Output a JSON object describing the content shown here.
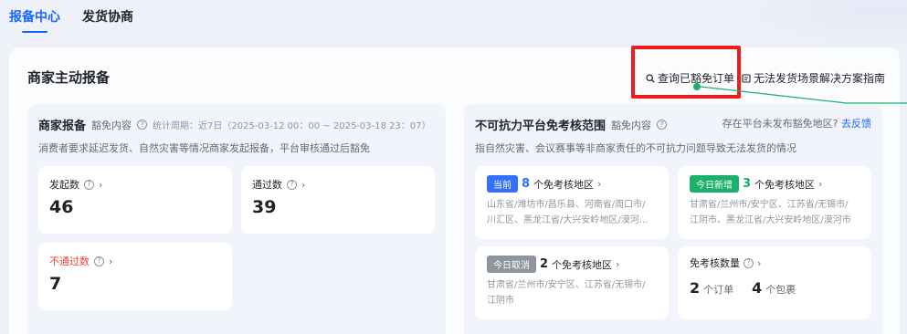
{
  "tabs": [
    {
      "label": "报备中心",
      "active": true
    },
    {
      "label": "发货协商",
      "active": false
    }
  ],
  "header": {
    "title": "商家主动报备",
    "query_link": "查询已豁免订单",
    "guide_link": "无法发货场景解决方案指南"
  },
  "left_panel": {
    "title": "商家报备",
    "subtitle": "豁免内容",
    "period": "统计周期：近7日（2025-03-12 00：00 ~ 2025-03-18 23：07）",
    "description": "消费者要求延迟发货、自然灾害等情况商家发起报备，平台审核通过后豁免",
    "stats": [
      {
        "label": "发起数",
        "value": "46"
      },
      {
        "label": "通过数",
        "value": "39"
      },
      {
        "label": "不通过数",
        "value": "7",
        "label_color": "#f53f3f"
      }
    ]
  },
  "right_panel": {
    "title": "不可抗力平台免考核范围",
    "subtitle": "豁免内容",
    "feedback_prefix": "存在平台未发布豁免地区?",
    "feedback_link": "去反馈",
    "description": "指自然灾害、会议赛事等非商家责任的不可抗力问题导致无法发货的情况",
    "cards": [
      {
        "badge": "当前",
        "badge_color": "#3370ff",
        "count": "8",
        "count_color": "#3370ff",
        "count_text": "个免考核地区",
        "regions": [
          "山东省/潍坊市/昌乐县、河南省/周口市/",
          "川汇区、黑龙江省/大兴安岭地区/漠河..."
        ]
      },
      {
        "badge": "今日新增",
        "badge_color": "#1bb06b",
        "count": "3",
        "count_color": "#1bb06b",
        "count_text": "个免考核地区",
        "regions": [
          "甘肃省/兰州市/安宁区、江苏省/无锡市/",
          "江阴市、黑龙江省/大兴安岭地区/漠河市"
        ]
      },
      {
        "badge": "今日取消",
        "badge_color": "#8f959e",
        "count": "2",
        "count_color": "#1f2329",
        "count_text": "个免考核地区",
        "regions": [
          "甘肃省/兰州市/安宁区、江苏省/无锡市/",
          "江阴市"
        ]
      }
    ],
    "quantity": {
      "label": "免考核数量",
      "orders": "2",
      "orders_unit": "个订单",
      "packages": "4",
      "packages_unit": "个包裹"
    }
  },
  "colors": {
    "accent": "#1966ff",
    "highlight": "#ee1d1d",
    "success": "#1bb06b"
  },
  "icons": {
    "query": "search-icon",
    "guide": "document-icon",
    "help": "question-circle-icon",
    "arrow": "chevron-right-icon"
  }
}
